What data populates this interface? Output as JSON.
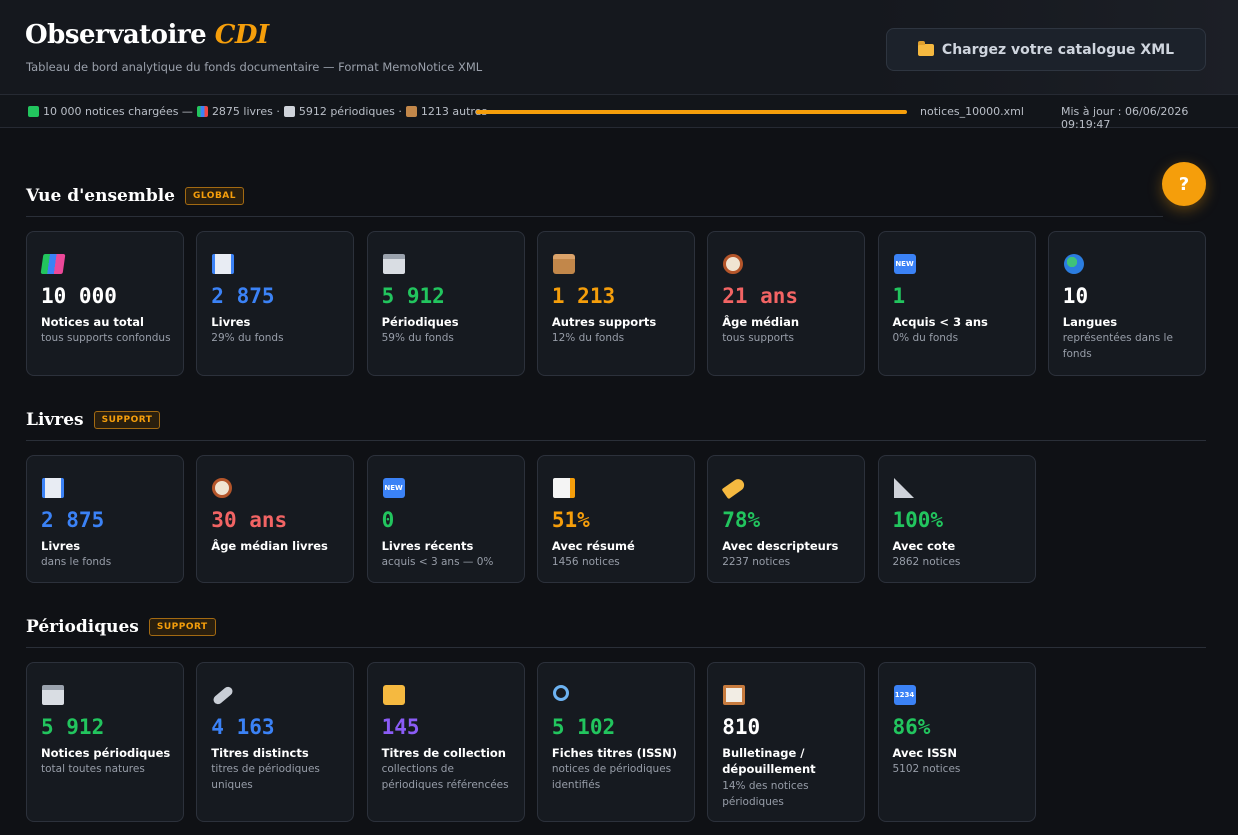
{
  "header": {
    "title_main": "Observatoire",
    "title_accent": "CDI",
    "subtitle": "Tableau de bord analytique du fonds documentaire — Format MemoNotice XML",
    "load_button": "Chargez votre catalogue XML"
  },
  "status": {
    "loaded": "10 000 notices chargées —",
    "books": "2875 livres ·",
    "periodicals": "5912 périodiques ·",
    "others": "1213 autres",
    "progress_fraction": 1.0,
    "filename": "notices_10000.xml",
    "updated": "Mis à jour : 06/06/2026 09:19:47"
  },
  "help": {
    "label": "?"
  },
  "sections": {
    "overview": {
      "title": "Vue d'ensemble",
      "badge": "GLOBAL",
      "cards": [
        {
          "icon": "books-icon",
          "value": "10 000",
          "label": "Notices au total",
          "sub": "tous supports confondus",
          "color": "#ffffff"
        },
        {
          "icon": "book-icon",
          "value": "2 875",
          "label": "Livres",
          "sub": "29% du fonds",
          "color": "#3b82f6"
        },
        {
          "icon": "newspaper-icon",
          "value": "5 912",
          "label": "Périodiques",
          "sub": "59% du fonds",
          "color": "#22c55e"
        },
        {
          "icon": "package-icon",
          "value": "1 213",
          "label": "Autres supports",
          "sub": "12% du fonds",
          "color": "#f59e0b"
        },
        {
          "icon": "clock-icon",
          "value": "21 ans",
          "label": "Âge médian",
          "sub": "tous supports",
          "color": "#f26464"
        },
        {
          "icon": "new-icon",
          "value": "1",
          "label": "Acquis < 3 ans",
          "sub": "0% du fonds",
          "color": "#22c55e"
        },
        {
          "icon": "globe-icon",
          "value": "10",
          "label": "Langues",
          "sub": "représentées dans le fonds",
          "color": "#ffffff"
        }
      ]
    },
    "books": {
      "title": "Livres",
      "badge": "SUPPORT",
      "cards": [
        {
          "icon": "book-icon",
          "value": "2 875",
          "label": "Livres",
          "sub": "dans le fonds",
          "color": "#3b82f6"
        },
        {
          "icon": "clock-icon",
          "value": "30 ans",
          "label": "Âge médian livres",
          "sub": "",
          "color": "#f26464"
        },
        {
          "icon": "new-icon",
          "value": "0",
          "label": "Livres récents",
          "sub": "acquis < 3 ans — 0%",
          "color": "#22c55e"
        },
        {
          "icon": "memo-icon",
          "value": "51%",
          "label": "Avec résumé",
          "sub": "1456 notices",
          "color": "#f59e0b"
        },
        {
          "icon": "tag-icon",
          "value": "78%",
          "label": "Avec descripteurs",
          "sub": "2237 notices",
          "color": "#22c55e"
        },
        {
          "icon": "ruler-icon",
          "value": "100%",
          "label": "Avec cote",
          "sub": "2862 notices",
          "color": "#22c55e"
        }
      ]
    },
    "periodicals": {
      "title": "Périodiques",
      "badge": "SUPPORT",
      "cards": [
        {
          "icon": "newspaper-icon",
          "value": "5 912",
          "label": "Notices périodiques",
          "sub": "total toutes natures",
          "color": "#22c55e"
        },
        {
          "icon": "link-icon",
          "value": "4 163",
          "label": "Titres distincts",
          "sub": "titres de périodiques uniques",
          "color": "#3b82f6"
        },
        {
          "icon": "folder-icon",
          "value": "145",
          "label": "Titres de collection",
          "sub": "collections de périodiques référencées",
          "color": "#8b5cf6"
        },
        {
          "icon": "search-icon",
          "value": "5 102",
          "label": "Fiches titres (ISSN)",
          "sub": "notices de périodiques identifiés",
          "color": "#22c55e"
        },
        {
          "icon": "clipboard-icon",
          "value": "810",
          "label": "Bulletinage / dépouillement",
          "sub": "14% des notices périodiques",
          "color": "#ffffff"
        },
        {
          "icon": "numbers-icon",
          "value": "86%",
          "label": "Avec ISSN",
          "sub": "5102 notices",
          "color": "#22c55e"
        }
      ]
    }
  }
}
